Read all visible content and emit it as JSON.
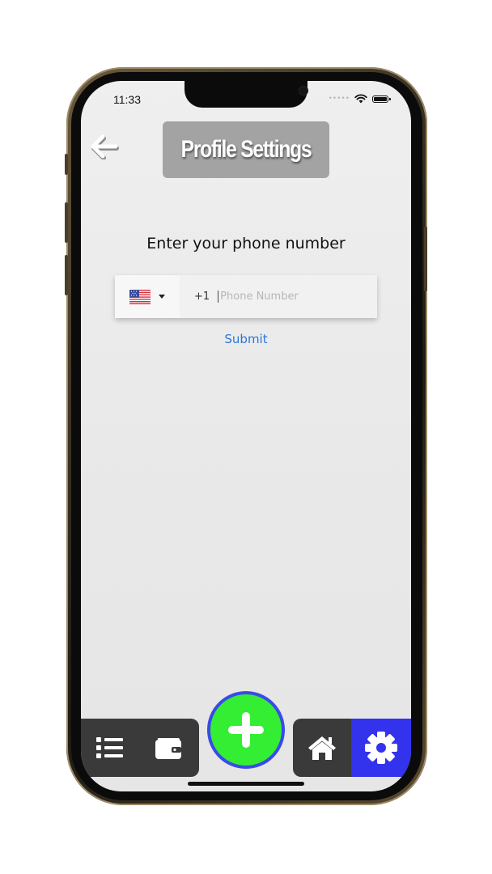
{
  "status_bar": {
    "time": "11:33",
    "signal_icon": "signal-dots-icon",
    "wifi_icon": "wifi-icon",
    "battery_icon": "battery-icon"
  },
  "header": {
    "back_icon": "arrow-left-icon",
    "title": "Profile Settings"
  },
  "form": {
    "prompt": "Enter your phone number",
    "country_flag": "us-flag-icon",
    "dial_code": "+1",
    "phone_value": "",
    "phone_placeholder": "Phone Number",
    "submit_label": "Submit"
  },
  "bottom_nav": {
    "items": [
      {
        "icon": "list-icon",
        "active": false
      },
      {
        "icon": "wallet-icon",
        "active": false
      },
      {
        "icon": "plus-icon",
        "active": false
      },
      {
        "icon": "home-icon",
        "active": false
      },
      {
        "icon": "gear-icon",
        "active": true
      }
    ]
  },
  "colors": {
    "title_bg": "#a3a3a3",
    "nav_bg": "#3a3a3a",
    "nav_active": "#3333ee",
    "fab_fill": "#33ee33",
    "fab_border": "#3a4ae8",
    "link": "#2a76d9"
  }
}
